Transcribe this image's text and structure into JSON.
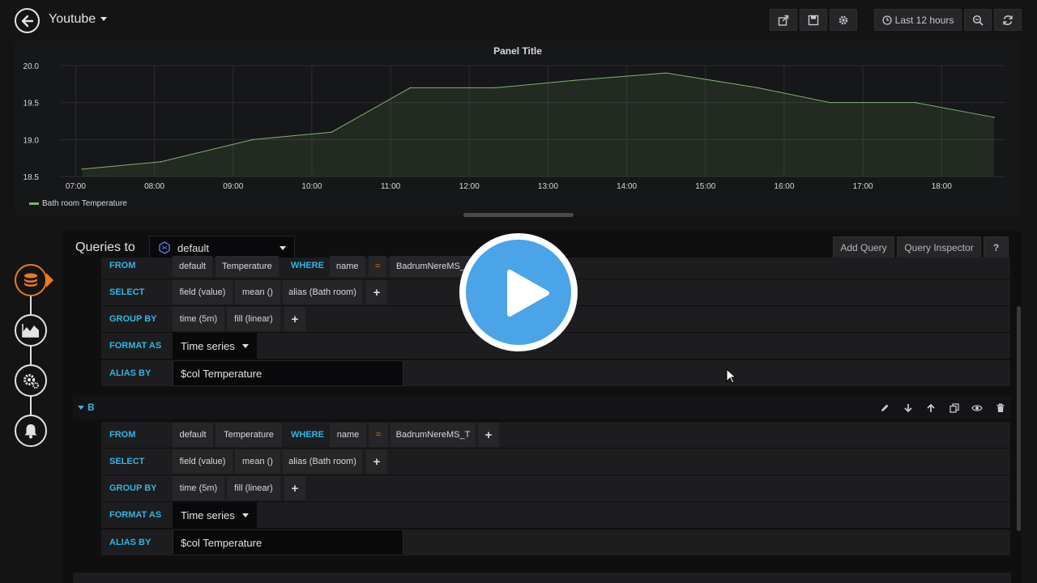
{
  "navbar": {
    "dashboard_title": "Youtube",
    "time_range_label": "Last 12 hours"
  },
  "panel": {
    "title": "Panel Title",
    "legend_label": "Bath room Temperature"
  },
  "chart_data": {
    "type": "area",
    "title": "Panel Title",
    "y_ticks": [
      "20.0",
      "19.5",
      "19.0",
      "18.5"
    ],
    "x_ticks": [
      "07:00",
      "08:00",
      "09:00",
      "10:00",
      "11:00",
      "12:00",
      "13:00",
      "14:00",
      "15:00",
      "16:00",
      "17:00",
      "18:00"
    ],
    "ylim": [
      18.5,
      20.0
    ],
    "series": [
      {
        "name": "Bath room Temperature",
        "color": "#7eb26d",
        "x": [
          "07:05",
          "08:05",
          "09:15",
          "10:15",
          "11:15",
          "12:20",
          "13:20",
          "14:30",
          "15:40",
          "16:35",
          "17:40",
          "18:40"
        ],
        "values": [
          18.6,
          18.7,
          19.0,
          19.1,
          19.7,
          19.7,
          19.8,
          19.9,
          19.7,
          19.5,
          19.5,
          19.3
        ]
      }
    ],
    "grid": true,
    "legend": "bottom-left"
  },
  "editor": {
    "queries_to_label": "Queries to",
    "datasource": "default",
    "add_query_label": "Add Query",
    "query_inspector_label": "Query Inspector",
    "help_label": "?"
  },
  "queryA": {
    "from_kw": "FROM",
    "from_db": "default",
    "from_measurement": "Temperature",
    "where_kw": "WHERE",
    "where_key": "name",
    "where_op": "=",
    "where_value": "BadrumNereMS_",
    "select_kw": "SELECT",
    "select_field": "field (value)",
    "select_fn": "mean ()",
    "select_alias": "alias (Bath room)",
    "group_kw": "GROUP BY",
    "group_time": "time (5m)",
    "group_fill": "fill (linear)",
    "format_kw": "FORMAT AS",
    "format_value": "Time series",
    "alias_kw": "ALIAS BY",
    "alias_value": "$col Temperature"
  },
  "queryB": {
    "ref_id": "B",
    "from_kw": "FROM",
    "from_db": "default",
    "from_measurement": "Temperature",
    "where_kw": "WHERE",
    "where_key": "name",
    "where_op": "=",
    "where_value": "BadrumNereMS_T",
    "select_kw": "SELECT",
    "select_field": "field (value)",
    "select_fn": "mean ()",
    "select_alias": "alias (Bath room)",
    "group_kw": "GROUP BY",
    "group_time": "time (5m)",
    "group_fill": "fill (linear)",
    "format_kw": "FORMAT AS",
    "format_value": "Time series",
    "alias_kw": "ALIAS BY",
    "alias_value": "$col Temperature"
  },
  "plus": "+"
}
